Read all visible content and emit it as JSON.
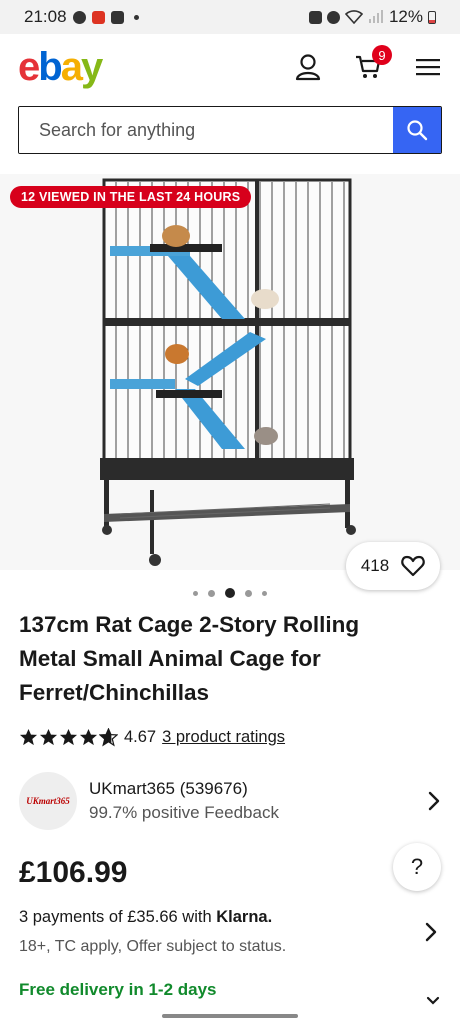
{
  "status_bar": {
    "time": "21:08",
    "battery": "12%"
  },
  "header": {
    "logo_letters": [
      "e",
      "b",
      "a",
      "y"
    ],
    "cart_count": "9"
  },
  "search": {
    "placeholder": "Search for anything"
  },
  "image": {
    "viewed_badge": "12 VIEWED IN THE LAST 24 HOURS",
    "watch_count": "418",
    "carousel_pages": 5,
    "carousel_active_index": 2
  },
  "product": {
    "title": "137cm Rat Cage 2-Story Rolling Metal Small Animal Cage for Ferret/Chinchillas",
    "rating_value": "4.67",
    "rating_link": "3 product ratings",
    "rating_stars": 4.67
  },
  "seller": {
    "logo_text": "UKmart365",
    "name": "UKmart365 (539676)",
    "feedback": "99.7% positive Feedback"
  },
  "pricing": {
    "price": "£106.99",
    "help_label": "?",
    "klarna_text": "3 payments of £35.66 with",
    "klarna_brand": "Klarna.",
    "klarna_sub": "18+, TC apply, Offer subject to status."
  },
  "delivery": {
    "text": "Free delivery in 1-2 days"
  },
  "colors": {
    "search_button": "#3665f3",
    "badge_red": "#d7001b",
    "delivery_green": "#118a2c"
  }
}
